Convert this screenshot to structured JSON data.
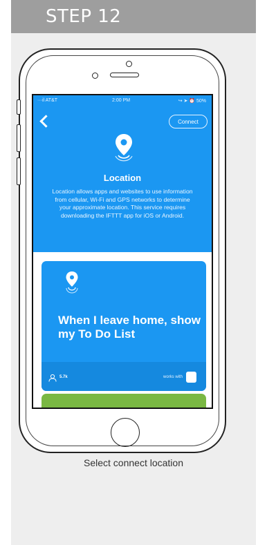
{
  "header": {
    "step_label": "STEP 12"
  },
  "status_bar": {
    "carrier": "···il AT&T",
    "time": "2:00 PM",
    "right": "↪ ➤ ⏰ 50%"
  },
  "service": {
    "connect_label": "Connect",
    "title": "Location",
    "description": "Location allows apps and websites to use information from cellular, Wi-Fi and GPS networks to determine your approximate location. This service requires downloading the IFTTT app for iOS or Android."
  },
  "applet": {
    "title": "When I leave home, show my To Do List",
    "user_count": "5.7k",
    "works_with_label": "works with"
  },
  "caption": "Select connect location",
  "colors": {
    "brand_blue": "#1b97f2",
    "footer_blue": "#1589df",
    "green": "#7ab843",
    "banner_gray": "#9e9e9e"
  }
}
